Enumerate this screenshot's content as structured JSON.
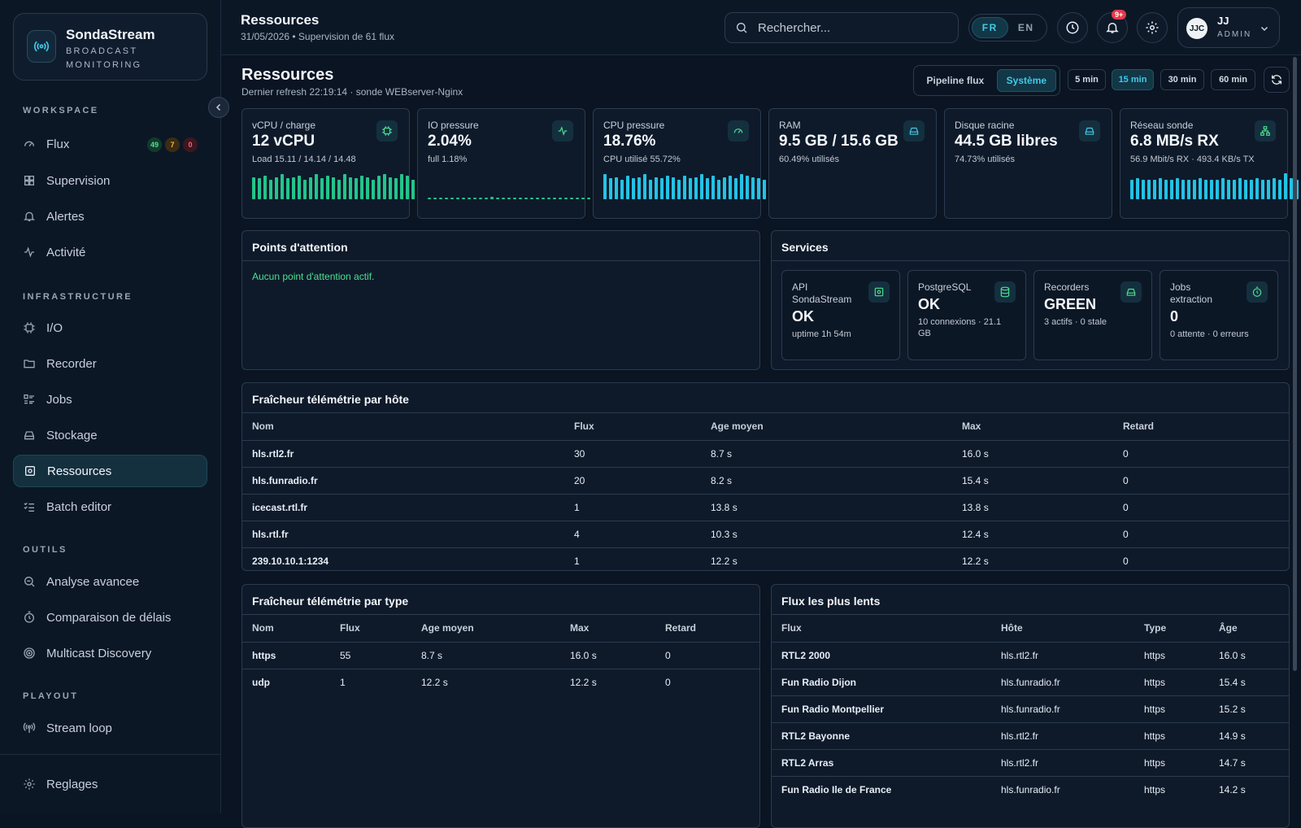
{
  "brand": {
    "name": "SondaStream",
    "subtitle": "BROADCAST MONITORING"
  },
  "sidebar": {
    "sections": [
      "WORKSPACE",
      "INFRASTRUCTURE",
      "OUTILS",
      "PLAYOUT"
    ],
    "items": [
      {
        "label": "Flux",
        "icon": "gauge-icon"
      },
      {
        "label": "Supervision",
        "icon": "grid-icon"
      },
      {
        "label": "Alertes",
        "icon": "bell-icon"
      },
      {
        "label": "Activité",
        "icon": "activity-icon"
      },
      {
        "label": "I/O",
        "icon": "cpu-icon"
      },
      {
        "label": "Recorder",
        "icon": "folder-icon"
      },
      {
        "label": "Jobs",
        "icon": "list-icon"
      },
      {
        "label": "Stockage",
        "icon": "drive-icon"
      },
      {
        "label": "Ressources",
        "icon": "server-icon"
      },
      {
        "label": "Batch editor",
        "icon": "checklist-icon"
      },
      {
        "label": "Analyse avancee",
        "icon": "search-zoom-icon"
      },
      {
        "label": "Comparaison de délais",
        "icon": "timer-icon"
      },
      {
        "label": "Multicast Discovery",
        "icon": "target-icon"
      },
      {
        "label": "Stream loop",
        "icon": "broadcast-icon"
      },
      {
        "label": "Reglages",
        "icon": "gear-icon"
      }
    ],
    "flux_badges": [
      "49",
      "7",
      "0"
    ]
  },
  "topbar": {
    "title": "Ressources",
    "subtitle": "31/05/2026 • Supervision de 61 flux",
    "search_placeholder": "Rechercher...",
    "lang": [
      "FR",
      "EN"
    ],
    "notif_count": "9+",
    "user": {
      "initials": "JJC",
      "name": "JJ",
      "role": "ADMIN"
    }
  },
  "page": {
    "title": "Ressources",
    "subtitle": "Dernier refresh 22:19:14 · sonde WEBserver-Nginx",
    "modes": [
      "Pipeline flux",
      "Système"
    ],
    "ranges": [
      "5 min",
      "15 min",
      "30 min",
      "60 min"
    ]
  },
  "kpis": [
    {
      "label": "vCPU / charge",
      "value": "12 vCPU",
      "sub": "Load 15.11 / 14.14 / 14.48",
      "icon": "chip-icon",
      "color": "#22c58b",
      "spark": [
        0.8,
        0.75,
        0.85,
        0.7,
        0.8,
        0.9,
        0.75,
        0.8,
        0.85,
        0.7,
        0.8,
        0.9,
        0.75,
        0.85,
        0.8,
        0.7,
        0.9,
        0.8,
        0.75,
        0.85,
        0.8,
        0.7,
        0.85,
        0.9,
        0.8,
        0.75,
        0.9,
        0.85,
        0.7,
        0.85
      ]
    },
    {
      "label": "IO pressure",
      "value": "2.04%",
      "sub": "full 1.18%",
      "icon": "pulse-icon",
      "color": "#22c58b",
      "spark": [
        0.06,
        0.06,
        0.06,
        0.06,
        0.06,
        0.06,
        0.06,
        0.06,
        0.06,
        0.06,
        0.06,
        0.1,
        0.06,
        0.06,
        0.06,
        0.06,
        0.06,
        0.06,
        0.06,
        0.06,
        0.06,
        0.06,
        0.06,
        0.06,
        0.06,
        0.06,
        0.06,
        0.06,
        0.06,
        0.06
      ]
    },
    {
      "label": "CPU pressure",
      "value": "18.76%",
      "sub": "CPU utilisé 55.72%",
      "icon": "speed-icon",
      "color": "#22c3e6",
      "spark": [
        0.9,
        0.75,
        0.8,
        0.7,
        0.85,
        0.75,
        0.8,
        0.9,
        0.7,
        0.8,
        0.75,
        0.85,
        0.8,
        0.7,
        0.85,
        0.75,
        0.8,
        0.9,
        0.75,
        0.85,
        0.7,
        0.8,
        0.85,
        0.75,
        0.9,
        0.85,
        0.8,
        0.75,
        0.7,
        0.85
      ]
    },
    {
      "label": "RAM",
      "value": "9.5 GB / 15.6 GB",
      "sub": "60.49% utilisés",
      "icon": "drive-icon",
      "color": "#22c3e6",
      "spark": []
    },
    {
      "label": "Disque racine",
      "value": "44.5 GB libres",
      "sub": "74.73% utilisés",
      "icon": "drive-icon",
      "color": "#22c3e6",
      "spark": []
    },
    {
      "label": "Réseau sonde",
      "value": "6.8 MB/s RX",
      "sub": "56.9 Mbit/s RX · 493.4 KB/s TX",
      "icon": "network-icon",
      "color": "#22c3e6",
      "spark": [
        0.7,
        0.75,
        0.7,
        0.72,
        0.7,
        0.75,
        0.7,
        0.72,
        0.75,
        0.7,
        0.72,
        0.7,
        0.75,
        0.7,
        0.72,
        0.7,
        0.75,
        0.72,
        0.7,
        0.75,
        0.72,
        0.7,
        0.75,
        0.7,
        0.72,
        0.75,
        0.7,
        0.95,
        0.75,
        0.72
      ]
    }
  ],
  "attention": {
    "title": "Points d'attention",
    "empty": "Aucun point d'attention actif."
  },
  "services": {
    "title": "Services",
    "items": [
      {
        "label": "API SondaStream",
        "value": "OK",
        "sub": "uptime 1h 54m",
        "icon": "api-icon"
      },
      {
        "label": "PostgreSQL",
        "value": "OK",
        "sub": "10 connexions · 21.1 GB",
        "icon": "database-icon"
      },
      {
        "label": "Recorders",
        "value": "GREEN",
        "sub": "3 actifs · 0 stale",
        "icon": "drive-icon"
      },
      {
        "label": "Jobs extraction",
        "value": "0",
        "sub": "0 attente · 0 erreurs",
        "icon": "stopwatch-icon"
      }
    ]
  },
  "host_table": {
    "title": "Fraîcheur télémétrie par hôte",
    "headers": [
      "Nom",
      "Flux",
      "Age moyen",
      "Max",
      "Retard"
    ],
    "rows": [
      [
        "hls.rtl2.fr",
        "30",
        "8.7 s",
        "16.0 s",
        "0"
      ],
      [
        "hls.funradio.fr",
        "20",
        "8.2 s",
        "15.4 s",
        "0"
      ],
      [
        "icecast.rtl.fr",
        "1",
        "13.8 s",
        "13.8 s",
        "0"
      ],
      [
        "hls.rtl.fr",
        "4",
        "10.3 s",
        "12.4 s",
        "0"
      ],
      [
        "239.10.10.1:1234",
        "1",
        "12.2 s",
        "12.2 s",
        "0"
      ]
    ]
  },
  "type_table": {
    "title": "Fraîcheur télémétrie par type",
    "headers": [
      "Nom",
      "Flux",
      "Age moyen",
      "Max",
      "Retard"
    ],
    "rows": [
      [
        "https",
        "55",
        "8.7 s",
        "16.0 s",
        "0"
      ],
      [
        "udp",
        "1",
        "12.2 s",
        "12.2 s",
        "0"
      ]
    ]
  },
  "slow_table": {
    "title": "Flux les plus lents",
    "headers": [
      "Flux",
      "Hôte",
      "Type",
      "Âge"
    ],
    "rows": [
      [
        "RTL2 2000",
        "hls.rtl2.fr",
        "https",
        "16.0 s"
      ],
      [
        "Fun Radio Dijon",
        "hls.funradio.fr",
        "https",
        "15.4 s"
      ],
      [
        "Fun Radio Montpellier",
        "hls.funradio.fr",
        "https",
        "15.2 s"
      ],
      [
        "RTL2 Bayonne",
        "hls.rtl2.fr",
        "https",
        "14.9 s"
      ],
      [
        "RTL2 Arras",
        "hls.rtl2.fr",
        "https",
        "14.7 s"
      ],
      [
        "Fun Radio Ile de France",
        "hls.funradio.fr",
        "https",
        "14.2 s"
      ]
    ]
  },
  "colors": {
    "accent": "#43c8e8",
    "ok": "#22c58b",
    "warn": "#f0b44c",
    "err": "#e5394a"
  }
}
